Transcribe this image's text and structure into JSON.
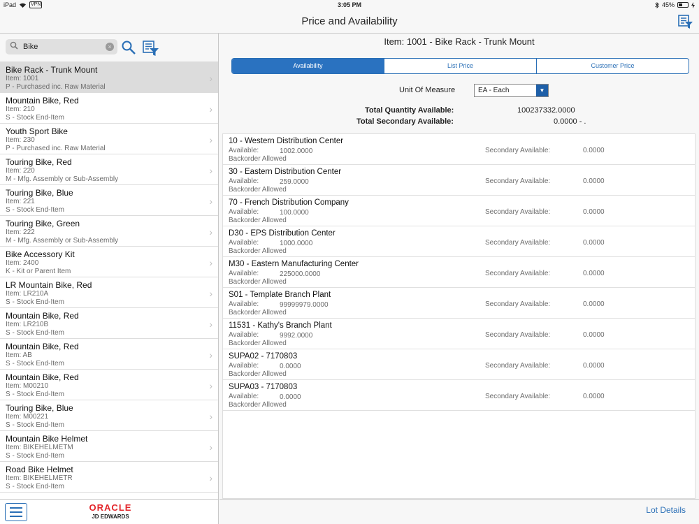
{
  "status": {
    "device": "iPad",
    "vpn": "VPN",
    "time": "3:05 PM",
    "battery": "45%",
    "battery_level": 0.45
  },
  "header": {
    "title": "Price and Availability"
  },
  "search": {
    "value": "Bike"
  },
  "items": [
    {
      "name": "Bike Rack - Trunk Mount",
      "item": "Item: 1001",
      "type": "P - Purchased inc. Raw Material",
      "selected": true
    },
    {
      "name": "Mountain Bike, Red",
      "item": "Item: 210",
      "type": "S - Stock End-Item"
    },
    {
      "name": "Youth Sport Bike",
      "item": "Item: 230",
      "type": "P - Purchased inc. Raw Material"
    },
    {
      "name": "Touring Bike, Red",
      "item": "Item: 220",
      "type": "M - Mfg. Assembly or Sub-Assembly"
    },
    {
      "name": "Touring Bike, Blue",
      "item": "Item: 221",
      "type": "S - Stock End-Item"
    },
    {
      "name": "Touring Bike, Green",
      "item": "Item: 222",
      "type": "M - Mfg. Assembly or Sub-Assembly"
    },
    {
      "name": "Bike Accessory Kit",
      "item": "Item: 2400",
      "type": "K - Kit or Parent Item"
    },
    {
      "name": "LR Mountain Bike, Red",
      "item": "Item: LR210A",
      "type": "S - Stock End-Item"
    },
    {
      "name": "Mountain Bike, Red",
      "item": "Item: LR210B",
      "type": "S - Stock End-Item"
    },
    {
      "name": "Mountain Bike, Red",
      "item": "Item: AB",
      "type": "S - Stock End-Item"
    },
    {
      "name": "Mountain Bike, Red",
      "item": "Item: M00210",
      "type": "S - Stock End-Item"
    },
    {
      "name": "Touring Bike, Blue",
      "item": "Item: M00221",
      "type": "S - Stock End-Item"
    },
    {
      "name": "Mountain Bike Helmet",
      "item": "Item: BIKEHELMETM",
      "type": "S - Stock End-Item"
    },
    {
      "name": "Road Bike Helmet",
      "item": "Item: BIKEHELMETR",
      "type": "S - Stock End-Item"
    }
  ],
  "logo": {
    "line1": "ORACLE",
    "line2": "JD EDWARDS"
  },
  "detail": {
    "title": "Item: 1001 - Bike Rack - Trunk Mount",
    "tabs": [
      "Availability",
      "List Price",
      "Customer Price"
    ],
    "uom_label": "Unit Of Measure",
    "uom_value": "EA - Each",
    "total_qty_label": "Total Quantity Available:",
    "total_qty_value": "100237332.0000",
    "total_sec_label": "Total Secondary Available:",
    "total_sec_value": "0.0000  - .",
    "available_label": "Available:",
    "backorder_label": "Backorder Allowed",
    "secondary_label": "Secondary Available:",
    "branches": [
      {
        "name": "10 - Western Distribution Center",
        "available": "1002.0000",
        "secondary": "0.0000"
      },
      {
        "name": "30 - Eastern Distribution Center",
        "available": "259.0000",
        "secondary": "0.0000"
      },
      {
        "name": "70 - French Distribution Company",
        "available": "100.0000",
        "secondary": "0.0000"
      },
      {
        "name": "D30 - EPS Distribution Center",
        "available": "1000.0000",
        "secondary": "0.0000"
      },
      {
        "name": "M30 - Eastern Manufacturing Center",
        "available": "225000.0000",
        "secondary": "0.0000"
      },
      {
        "name": "S01 - Template Branch Plant",
        "available": "99999979.0000",
        "secondary": "0.0000"
      },
      {
        "name": "11531 - Kathy's Branch Plant",
        "available": "9992.0000",
        "secondary": "0.0000"
      },
      {
        "name": "SUPA02 - 7170803",
        "available": "0.0000",
        "secondary": "0.0000"
      },
      {
        "name": "SUPA03 - 7170803",
        "available": "0.0000",
        "secondary": "0.0000"
      }
    ],
    "lot_details": "Lot Details"
  }
}
